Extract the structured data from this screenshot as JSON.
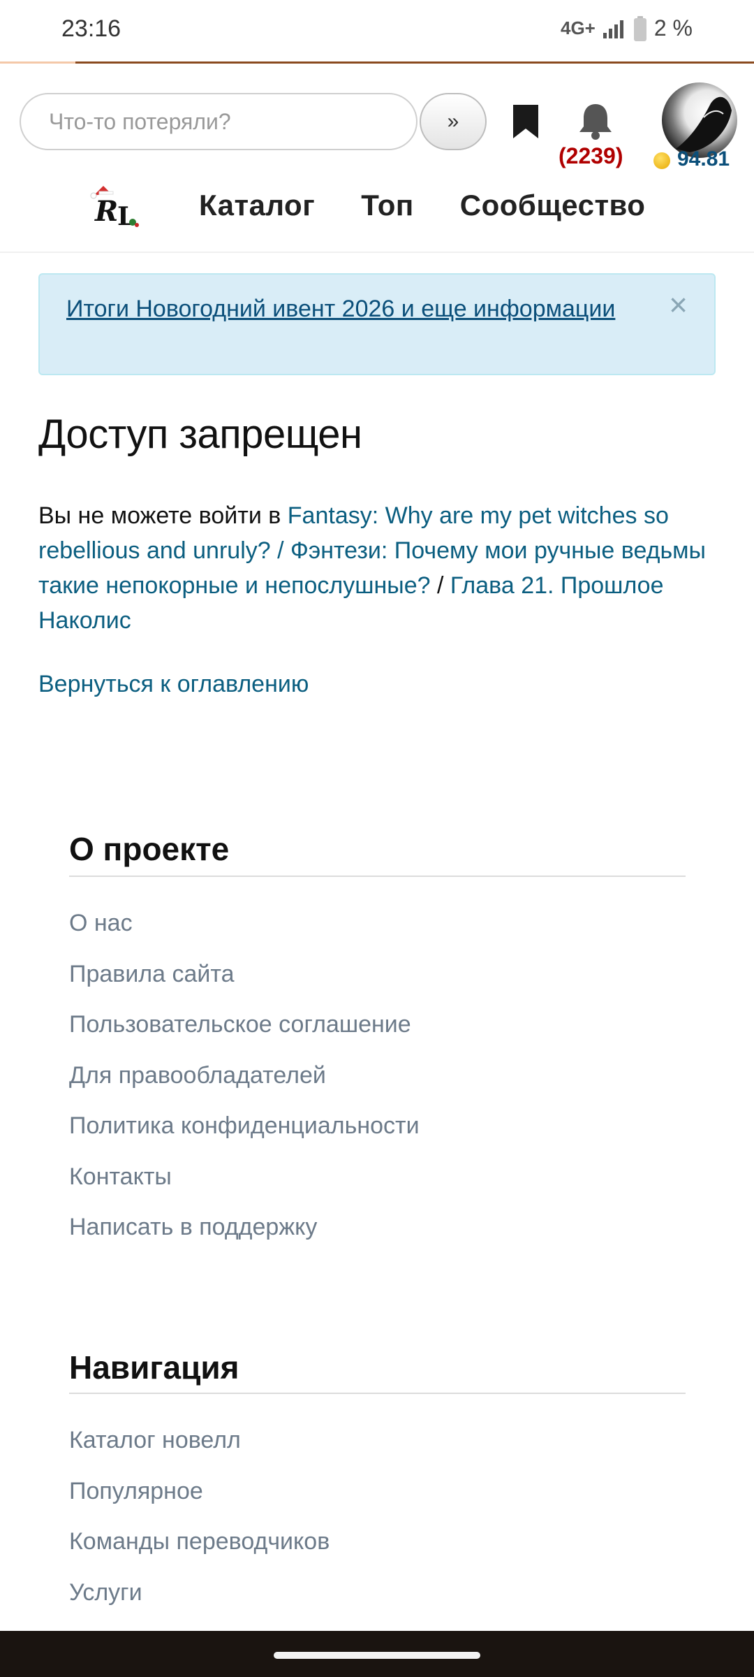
{
  "status_bar": {
    "time": "23:16",
    "network": "4G+",
    "battery": "2 %"
  },
  "page_load_progress": 0.1,
  "header": {
    "search_placeholder": "Что-то потеряли?",
    "go_button": "»",
    "notifications_count": "(2239)",
    "balance": "94.81"
  },
  "nav": {
    "items": [
      "Каталог",
      "Топ",
      "Сообщество"
    ]
  },
  "alert": {
    "text": "Итоги Новогодний ивент 2026 и еще информации",
    "close": "×"
  },
  "main": {
    "title": "Доступ запрещен",
    "prefix": "Вы не можете войти в ",
    "novel_link": "Fantasy: Why are my pet witches so rebellious and unruly? / Фэнтези: Почему мои ручные ведьмы такие непокорные и непослушные?",
    "separator": " / ",
    "chapter_link": "Глава 21. Прошлое Наколис",
    "back_link": "Вернуться к оглавлению"
  },
  "footer": {
    "about": {
      "title": "О проекте",
      "links": [
        "О нас",
        "Правила сайта",
        "Пользовательское соглашение",
        "Для правообладателей",
        "Политика конфиденциальности",
        "Контакты",
        "Написать в поддержку"
      ]
    },
    "navigation": {
      "title": "Навигация",
      "links": [
        "Каталог новелл",
        "Популярное",
        "Команды переводчиков",
        "Услуги"
      ]
    }
  },
  "colors": {
    "link": "#0b5e80",
    "alert_bg": "#d9edf7",
    "notification_red": "#b00000",
    "footer_link": "#6c7a89"
  }
}
